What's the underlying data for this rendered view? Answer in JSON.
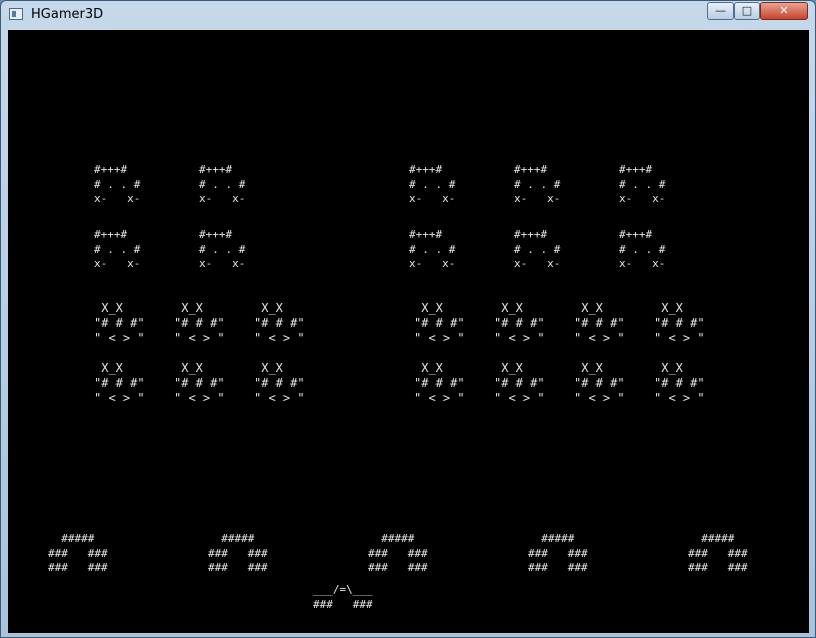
{
  "window": {
    "title": "HGamer3D",
    "controls": {
      "minimize": "—",
      "maximize": "□",
      "close": "✕"
    }
  },
  "sprites": {
    "invader_a": "#+++#\n# . . #\nx-   x-",
    "invader_b": " X_X\n\"# # #\"\n\" < > \"",
    "shield": "  #####\n###   ###\n###   ###",
    "player": "___/=\\___\n###   ###"
  },
  "icons": {
    "app": "window-icon",
    "minimize": "minimize-icon",
    "maximize": "maximize-icon",
    "close": "close-icon"
  }
}
